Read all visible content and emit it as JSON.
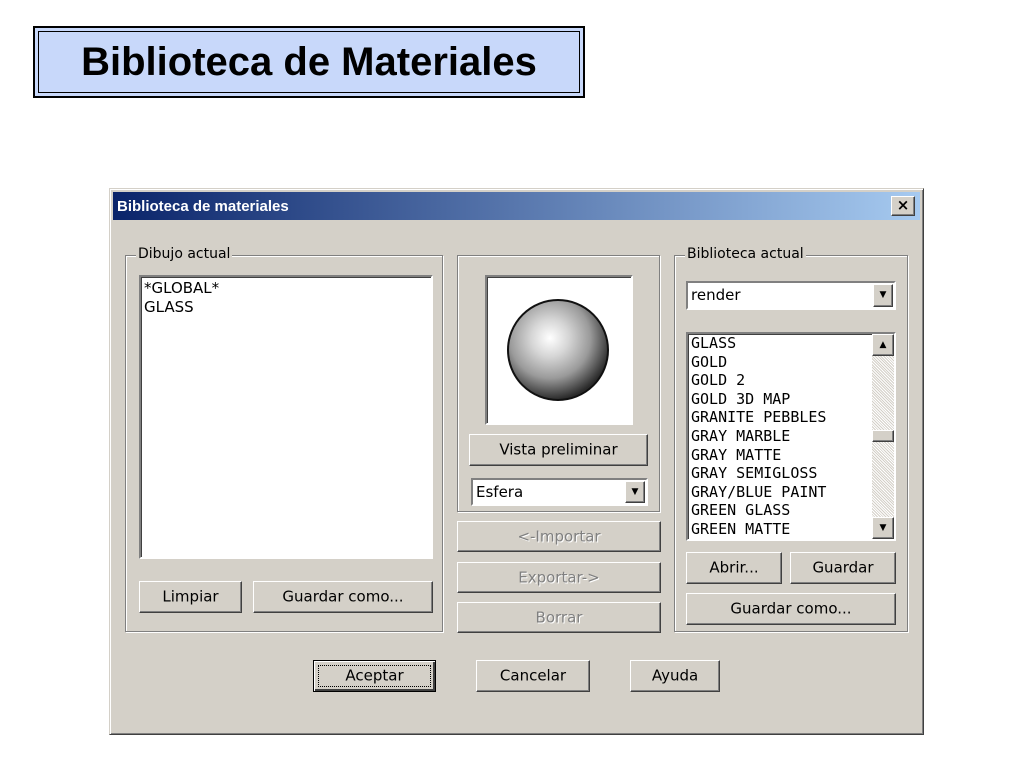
{
  "slide": {
    "title": "Biblioteca de Materiales"
  },
  "dialog": {
    "title": "Biblioteca de materiales",
    "close_label": "×",
    "current_drawing": {
      "label": "Dibujo actual",
      "items": [
        "*GLOBAL*",
        "GLASS"
      ],
      "clear_label": "Limpiar",
      "save_as_label": "Guardar como..."
    },
    "preview": {
      "button_label": "Vista preliminar",
      "shape_value": "Esfera",
      "import_label": "<-Importar",
      "export_label": "Exportar->",
      "delete_label": "Borrar"
    },
    "current_library": {
      "label": "Biblioteca actual",
      "library_value": "render",
      "items": [
        "GLASS",
        "GOLD",
        "GOLD 2",
        "GOLD 3D MAP",
        "GRANITE PEBBLES",
        "GRAY MARBLE",
        "GRAY MATTE",
        "GRAY SEMIGLOSS",
        "GRAY/BLUE PAINT",
        "GREEN GLASS",
        "GREEN MATTE"
      ],
      "open_label": "Abrir...",
      "save_label": "Guardar",
      "save_as_label": "Guardar como..."
    },
    "footer": {
      "ok_label": "Aceptar",
      "cancel_label": "Cancelar",
      "help_label": "Ayuda"
    }
  }
}
